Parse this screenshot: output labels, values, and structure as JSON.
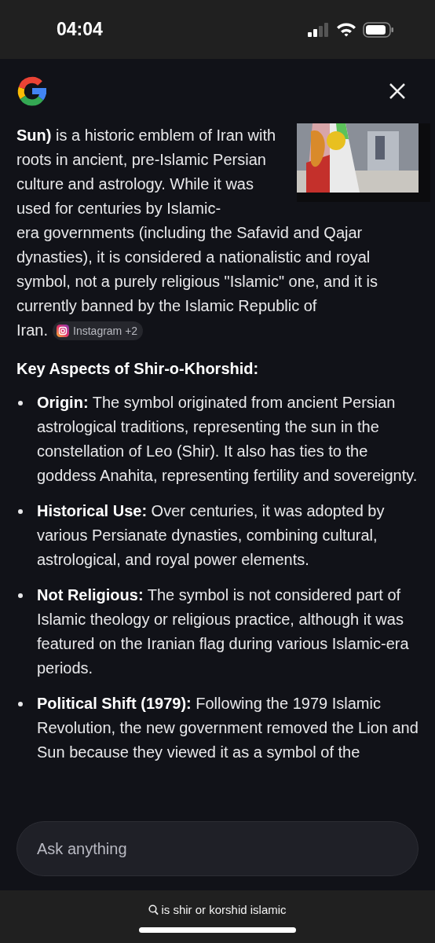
{
  "status_bar": {
    "time": "04:04"
  },
  "answer": {
    "intro": [
      "**Sun)** is a historic emblem of Iran with roots in ancient, pre-Islamic Persian culture and astrology. While it was used for centuries by Islamic-",
      "era governments (including the Safavid and Qajar dynasties), it is considered a nationalistic and royal symbol, not a purely religious \"Islamic\" one, and it is currently banned by the Islamic Republic of",
      "Iran."
    ],
    "source_chip": "Instagram +2",
    "heading": "Key Aspects of Shir-o-Khorshid:",
    "points": [
      {
        "text": "**Origin:** The symbol originated from ancient Persian astrological traditions, representing the sun in the constellation of Leo (Shir). It also has ties to the goddess Anahita, representing fertility and sovereignty."
      },
      {
        "text": "**Historical Use:** Over centuries, it was adopted by various Persianate dynasties, combining cultural, astrological, and royal power elements."
      },
      {
        "text": "**Not Religious:** The symbol is not considered part of Islamic theology or religious practice, although it was featured on the Iranian flag during various Islamic-era periods."
      },
      {
        "text": "**Political Shift (1979):** Following the 1979 Islamic Revolution, the new government removed the Lion and Sun because they viewed it as a symbol of the"
      }
    ]
  },
  "ask_field": {
    "placeholder": "Ask anything"
  },
  "bottom_bar": {
    "query": "is shir or korshid islamic"
  }
}
